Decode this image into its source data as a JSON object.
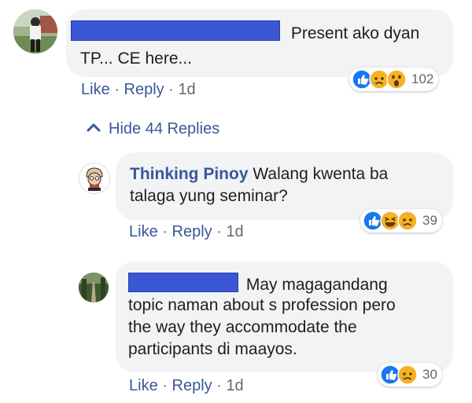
{
  "comments": [
    {
      "author": "",
      "text": "Present ako dyan",
      "text_line2": "TP... CE here...",
      "actions": {
        "like": "Like",
        "reply": "Reply",
        "time": "1d",
        "sep": "·"
      },
      "reactions": {
        "icons": [
          "like-icon",
          "sad-icon",
          "wow-icon"
        ],
        "count": "102"
      }
    }
  ],
  "hide_replies": {
    "label": "Hide 44 Replies",
    "icon": "chevron-up-icon"
  },
  "replies": [
    {
      "author": "Thinking Pinoy",
      "text": "Walang kwenta ba",
      "text_line2": "talaga yung seminar?",
      "actions": {
        "like": "Like",
        "reply": "Reply",
        "time": "1d",
        "sep": "·"
      },
      "reactions": {
        "icons": [
          "like-icon",
          "haha-icon",
          "sad-icon"
        ],
        "count": "39"
      }
    },
    {
      "author": "",
      "lines": [
        "May magagandang",
        "topic naman about s profession pero",
        "the way they accommodate the",
        "participants di maayos."
      ],
      "actions": {
        "like": "Like",
        "reply": "Reply",
        "time": "1d",
        "sep": "·"
      },
      "reactions": {
        "icons": [
          "like-icon",
          "sad-icon"
        ],
        "count": "30"
      }
    }
  ],
  "colors": {
    "link": "#385898",
    "bubble": "#f2f3f5",
    "redaction": "#3b57d6",
    "like": "#1877f2",
    "emoji": "#f7b125"
  }
}
